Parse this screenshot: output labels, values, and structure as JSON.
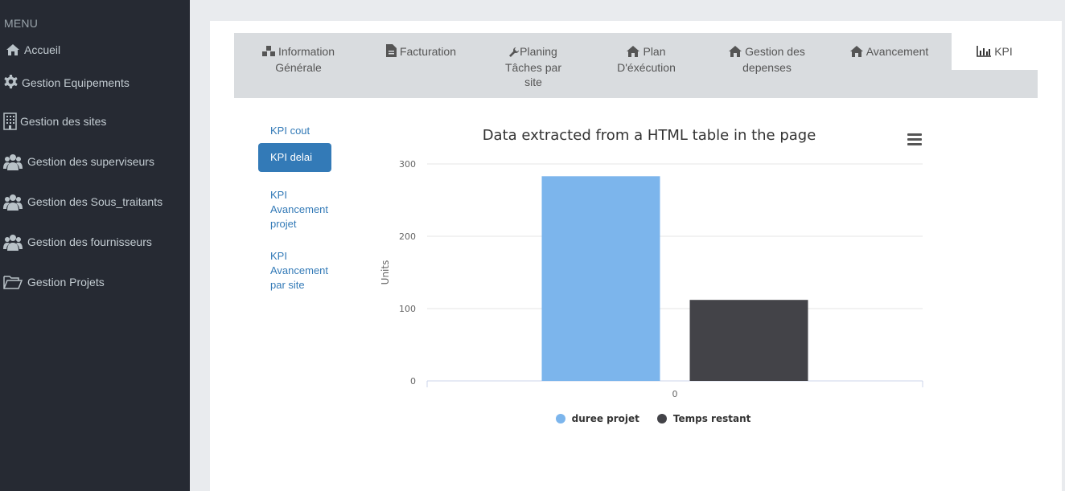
{
  "sidebar": {
    "header": "MENU",
    "items": [
      {
        "label": "Accueil",
        "icon": "home-icon"
      },
      {
        "label": "Gestion Equipements",
        "icon": "gear-icon"
      },
      {
        "label": "Gestion des sites",
        "icon": "building-icon"
      },
      {
        "label": "Gestion des superviseurs",
        "icon": "users-icon"
      },
      {
        "label": "Gestion des Sous_traitants",
        "icon": "users-icon"
      },
      {
        "label": "Gestion des fournisseurs",
        "icon": "users-icon"
      },
      {
        "label": "Gestion Projets",
        "icon": "folder-open-icon"
      }
    ]
  },
  "tabs": [
    {
      "label_1": "Information",
      "label_2": "Générale",
      "label_3": "",
      "icon": "cubes-icon"
    },
    {
      "label_1": "Facturation",
      "label_2": "",
      "label_3": "",
      "icon": "file-icon"
    },
    {
      "label_1": "Planing",
      "label_2": "Tâches par",
      "label_3": "site",
      "icon": "wrench-icon"
    },
    {
      "label_1": "Plan",
      "label_2": "D'éxécution",
      "label_3": "",
      "icon": "home-icon"
    },
    {
      "label_1": "Gestion des",
      "label_2": "depenses",
      "label_3": "",
      "icon": "home-icon"
    },
    {
      "label_1": "Avancement",
      "label_2": "",
      "label_3": "",
      "icon": "home-icon"
    },
    {
      "label_1": "KPI",
      "label_2": "",
      "label_3": "",
      "icon": "bar-chart-icon",
      "active": true
    }
  ],
  "pills": [
    {
      "l1": "KPI cout",
      "l2": "",
      "l3": ""
    },
    {
      "l1": "KPI delai",
      "l2": "",
      "l3": "",
      "active": true
    },
    {
      "l1": "KPI",
      "l2": "Avancement",
      "l3": "projet"
    },
    {
      "l1": "KPI",
      "l2": "Avancement",
      "l3": "par site"
    }
  ],
  "chart_data": {
    "type": "bar",
    "title": "Data extracted from a HTML table in the page",
    "xlabel": "",
    "ylabel": "Units",
    "categories": [
      "0"
    ],
    "ylim": [
      0,
      300
    ],
    "yticks": [
      0,
      100,
      200,
      300
    ],
    "grid": true,
    "legend_position": "bottom",
    "series": [
      {
        "name": "duree projet",
        "values": [
          283
        ],
        "color": "#7cb5ec"
      },
      {
        "name": "Temps restant",
        "values": [
          112
        ],
        "color": "#434348"
      }
    ]
  }
}
